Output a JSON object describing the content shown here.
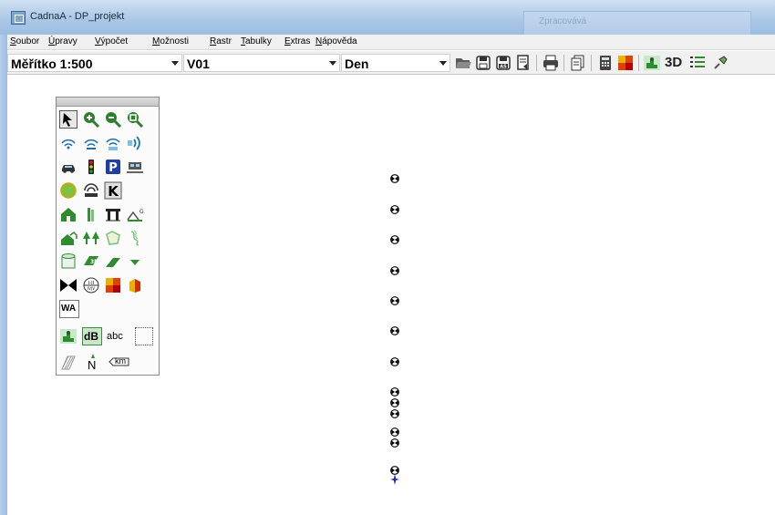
{
  "window": {
    "title": "CadnaA - DP_projekt",
    "background_window_title": "Zpracovává"
  },
  "menu": {
    "items": [
      {
        "accel": "S",
        "rest": "oubor"
      },
      {
        "accel": "Ú",
        "rest": "pravy"
      },
      {
        "accel": "V",
        "rest": "ýpočet"
      },
      {
        "accel": "M",
        "rest": "ožnosti"
      },
      {
        "accel": "R",
        "rest": "astr"
      },
      {
        "accel": "T",
        "rest": "abulky"
      },
      {
        "accel": "E",
        "rest": "xtras"
      },
      {
        "accel": "N",
        "rest": "ápověda"
      }
    ]
  },
  "toolbar": {
    "scale_value": "Měřítko 1:500",
    "variant_value": "V01",
    "period_value": "Den",
    "label_3d": "3D",
    "icons": [
      "open-folder-icon",
      "save-icon",
      "save-as-icon",
      "export-icon",
      "print-icon",
      "document-icon",
      "calculator-icon",
      "grid-map-icon",
      "receiver-grid-icon",
      "3d-view-icon",
      "layers-icon",
      "pin-icon"
    ]
  },
  "palette": {
    "label_wa": "WA",
    "label_db": "dB",
    "label_abc": "abc",
    "label_north": "N",
    "label_km": "km",
    "icons": [
      "pointer-icon",
      "zoom-in-icon",
      "zoom-out-icon",
      "zoom-window-icon",
      "source-wave-icon",
      "line-source-wave-icon",
      "area-source-wave-icon",
      "emission-wave-icon",
      "road-car-icon",
      "traffic-light-icon",
      "parking-icon",
      "railway-icon",
      "green-circle-icon",
      "tunnel-icon",
      "k-icon",
      "building-icon",
      "barrier-icon",
      "bridge-icon",
      "ground-absorption-icon",
      "residential-icon",
      "trees-icon",
      "area-outline-icon",
      "contour-icon",
      "cylinder-icon",
      "3d-object-icon",
      "terrain-slope-icon",
      "triangle-marker-icon",
      "receiver-bowtie-icon",
      "receiver-point-icon",
      "grid-cells-icon",
      "grid-building-icon",
      "wa-icon",
      "receiver-grid-icon",
      "db-icon",
      "abc-text-icon",
      "selection-rect-icon",
      "hatch-icon",
      "north-arrow-icon",
      "km-scale-icon"
    ]
  },
  "canvas": {
    "receiver_points": 13,
    "marker": "cross-marker"
  },
  "colors": {
    "title_bar": "#a9c6e6",
    "toolbar_bg": "#f0f0f0",
    "receiver": "#000000",
    "cross_marker": "#1f2aa8"
  }
}
